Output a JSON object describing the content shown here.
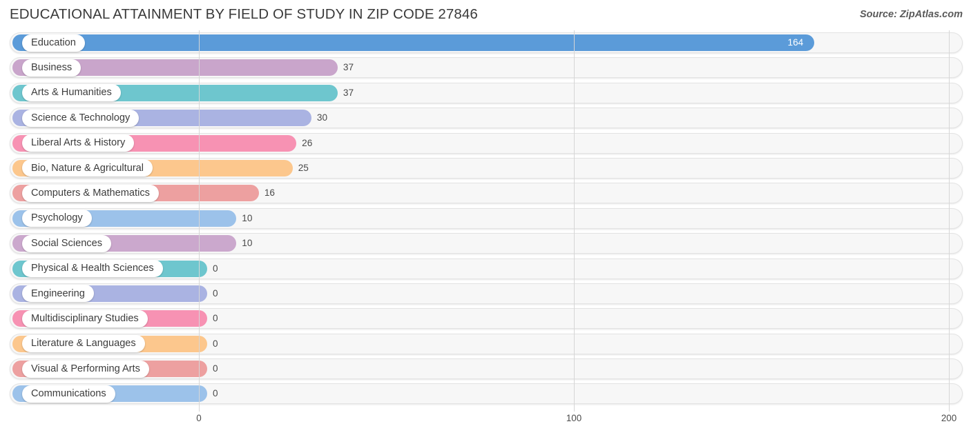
{
  "header": {
    "title": "EDUCATIONAL ATTAINMENT BY FIELD OF STUDY IN ZIP CODE 27846",
    "source": "Source: ZipAtlas.com"
  },
  "chart_data": {
    "type": "bar",
    "orientation": "horizontal",
    "title": "EDUCATIONAL ATTAINMENT BY FIELD OF STUDY IN ZIP CODE 27846",
    "xlabel": "",
    "ylabel": "",
    "xlim": [
      0,
      200
    ],
    "xticks": [
      0,
      100,
      200
    ],
    "xtick_labels": [
      "0",
      "100",
      "200"
    ],
    "grid": true,
    "legend": false,
    "categories": [
      "Education",
      "Business",
      "Arts & Humanities",
      "Science & Technology",
      "Liberal Arts & History",
      "Bio, Nature & Agricultural",
      "Computers & Mathematics",
      "Psychology",
      "Social Sciences",
      "Physical & Health Sciences",
      "Engineering",
      "Multidisciplinary Studies",
      "Literature & Languages",
      "Visual & Performing Arts",
      "Communications"
    ],
    "values": [
      164,
      37,
      37,
      30,
      26,
      25,
      16,
      10,
      10,
      0,
      0,
      0,
      0,
      0,
      0
    ],
    "value_labels": [
      "164",
      "37",
      "37",
      "30",
      "26",
      "25",
      "16",
      "10",
      "10",
      "0",
      "0",
      "0",
      "0",
      "0",
      "0"
    ],
    "colors": [
      "#5b9bd9",
      "#c9a5cb",
      "#6ec6ce",
      "#aab3e2",
      "#f792b3",
      "#fcc78d",
      "#eda0a0",
      "#9cc2ea",
      "#cba8cd",
      "#6ec6ce",
      "#aab3e2",
      "#f792b3",
      "#fcc78d",
      "#eda0a0",
      "#9cc2ea"
    ]
  }
}
